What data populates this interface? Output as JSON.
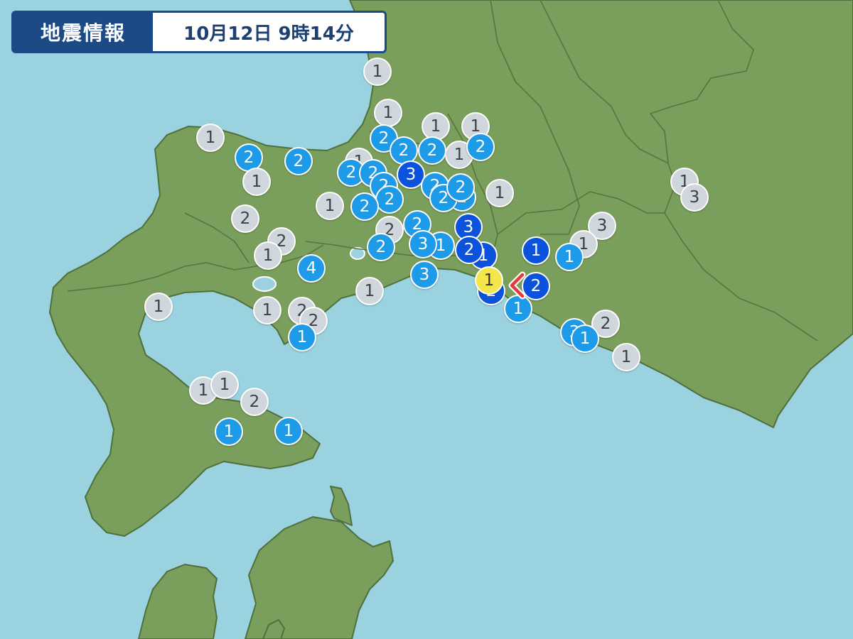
{
  "header": {
    "title": "地震情報",
    "datetime": "10月12日 9時14分"
  },
  "colors": {
    "sea": "#9bd2e0",
    "land": "#7a9e5b",
    "header_bg": "#1c4a86",
    "intensity_1": "#cfd6dc",
    "intensity_2": "#1e9be8",
    "intensity_3": "#0b52dc",
    "intensity_4": "#f2e64a",
    "epicenter": "#e23b3b"
  },
  "epicenter_icon": "x-mark-icon",
  "stations": [
    {
      "intensity": "1"
    },
    {
      "intensity": "1"
    },
    {
      "intensity": "1"
    },
    {
      "intensity": "1"
    },
    {
      "intensity": "1"
    },
    {
      "intensity": "2"
    },
    {
      "intensity": "1"
    },
    {
      "intensity": "2"
    },
    {
      "intensity": "1"
    },
    {
      "intensity": "2"
    },
    {
      "intensity": "2"
    },
    {
      "intensity": "2"
    },
    {
      "intensity": "2"
    },
    {
      "intensity": "2"
    },
    {
      "intensity": "3"
    },
    {
      "intensity": "2"
    },
    {
      "intensity": "2"
    },
    {
      "intensity": "2"
    },
    {
      "intensity": "2"
    },
    {
      "intensity": "2"
    },
    {
      "intensity": "2"
    },
    {
      "intensity": "1"
    },
    {
      "intensity": "2"
    },
    {
      "intensity": "1"
    },
    {
      "intensity": "1"
    },
    {
      "intensity": "1"
    },
    {
      "intensity": "2"
    },
    {
      "intensity": "3"
    },
    {
      "intensity": "2"
    },
    {
      "intensity": "2"
    },
    {
      "intensity": "2"
    },
    {
      "intensity": "3"
    },
    {
      "intensity": "3"
    },
    {
      "intensity": "2"
    },
    {
      "intensity": "1"
    },
    {
      "intensity": "3"
    },
    {
      "intensity": "2"
    },
    {
      "intensity": "1"
    },
    {
      "intensity": "2"
    },
    {
      "intensity": "1"
    },
    {
      "intensity": "1"
    },
    {
      "intensity": "1"
    },
    {
      "intensity": "1"
    },
    {
      "intensity": "4"
    },
    {
      "intensity": "3"
    },
    {
      "intensity": "2"
    },
    {
      "intensity": "1"
    },
    {
      "intensity": "2"
    },
    {
      "intensity": "1"
    },
    {
      "intensity": "1"
    },
    {
      "intensity": "1"
    },
    {
      "intensity": "1"
    },
    {
      "intensity": "2"
    },
    {
      "intensity": "2"
    },
    {
      "intensity": "1"
    },
    {
      "intensity": "3"
    },
    {
      "intensity": "2"
    },
    {
      "intensity": "1"
    },
    {
      "intensity": "1"
    },
    {
      "intensity": "1"
    },
    {
      "intensity": "1"
    },
    {
      "intensity": "2"
    },
    {
      "intensity": "1"
    },
    {
      "intensity": "1"
    }
  ]
}
